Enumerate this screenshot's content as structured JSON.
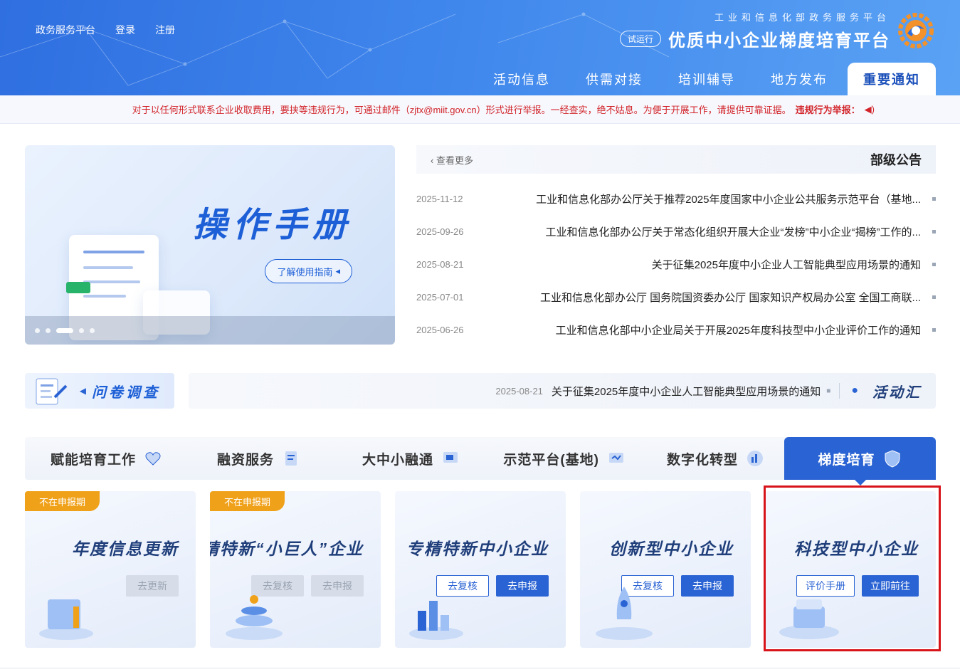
{
  "header": {
    "logo_sub": "工业和信息化部政务服务平台",
    "logo_main": "优质中小企业梯度培育平台",
    "trial_badge": "试运行",
    "top_links": [
      "政务服务平台",
      "登录",
      "注册"
    ],
    "nav": [
      {
        "label": "重要通知",
        "active": true
      },
      {
        "label": "地方发布",
        "active": false
      },
      {
        "label": "培训辅导",
        "active": false
      },
      {
        "label": "供需对接",
        "active": false
      },
      {
        "label": "活动信息",
        "active": false
      }
    ]
  },
  "notice": {
    "label": "违规行为举报：",
    "text": "对于以任何形式联系企业收取费用，要挟等违规行为，可通过邮件（zjtx@miit.gov.cn）形式进行举报。一经查实，绝不姑息。为便于开展工作，请提供可靠证据。"
  },
  "banner": {
    "title": "操作手册",
    "button": "了解使用指南",
    "dots": 5,
    "active_dot": 3
  },
  "announcements": {
    "title": "部级公告",
    "more": "查看更多",
    "items": [
      {
        "text": "工业和信息化部办公厅关于推荐2025年度国家中小企业公共服务示范平台（基地...",
        "date": "2025-11-12"
      },
      {
        "text": "工业和信息化部办公厅关于常态化组织开展大企业“发榜”中小企业“揭榜”工作的...",
        "date": "2025-09-26"
      },
      {
        "text": "关于征集2025年度中小企业人工智能典型应用场景的通知",
        "date": "2025-08-21"
      },
      {
        "text": "工业和信息化部办公厅 国务院国资委办公厅 国家知识产权局办公室 全国工商联...",
        "date": "2025-07-01"
      },
      {
        "text": "工业和信息化部中小企业局关于开展2025年度科技型中小企业评价工作的通知",
        "date": "2025-06-26"
      }
    ]
  },
  "survey": {
    "title": "问卷调查"
  },
  "activity": {
    "title": "活动汇",
    "text": "关于征集2025年度中小企业人工智能典型应用场景的通知",
    "date": "2025-08-21"
  },
  "tabs": [
    {
      "label": "梯度培育",
      "icon": "shield-icon",
      "active": true
    },
    {
      "label": "数字化转型",
      "icon": "chart-icon",
      "active": false
    },
    {
      "label": "示范平台(基地)",
      "icon": "monitor-icon",
      "active": false
    },
    {
      "label": "大中小融通",
      "icon": "screen-icon",
      "active": false
    },
    {
      "label": "融资服务",
      "icon": "document-icon",
      "active": false
    },
    {
      "label": "赋能培育工作",
      "icon": "heart-icon",
      "active": false
    }
  ],
  "cards": [
    {
      "title": "科技型中小企业",
      "badge": "",
      "buttons": [
        {
          "label": "立即前往",
          "style": "primary"
        },
        {
          "label": "评价手册",
          "style": "outline"
        }
      ]
    },
    {
      "title": "创新型中小企业",
      "badge": "",
      "buttons": [
        {
          "label": "去申报",
          "style": "primary"
        },
        {
          "label": "去复核",
          "style": "outline"
        }
      ]
    },
    {
      "title": "专精特新中小企业",
      "badge": "",
      "buttons": [
        {
          "label": "去申报",
          "style": "primary"
        },
        {
          "label": "去复核",
          "style": "outline"
        }
      ]
    },
    {
      "title": "专精特新“小巨人”企业",
      "badge": "不在申报期",
      "buttons": [
        {
          "label": "去申报",
          "style": "disabled"
        },
        {
          "label": "去复核",
          "style": "disabled"
        }
      ]
    },
    {
      "title": "年度信息更新",
      "badge": "不在申报期",
      "buttons": [
        {
          "label": "去更新",
          "style": "disabled"
        }
      ]
    }
  ],
  "colors": {
    "primary": "#2a63d3",
    "header": "#3f86ec",
    "badge": "#f0a11a",
    "alert": "#d2242a",
    "highlight": "#d7141a"
  }
}
